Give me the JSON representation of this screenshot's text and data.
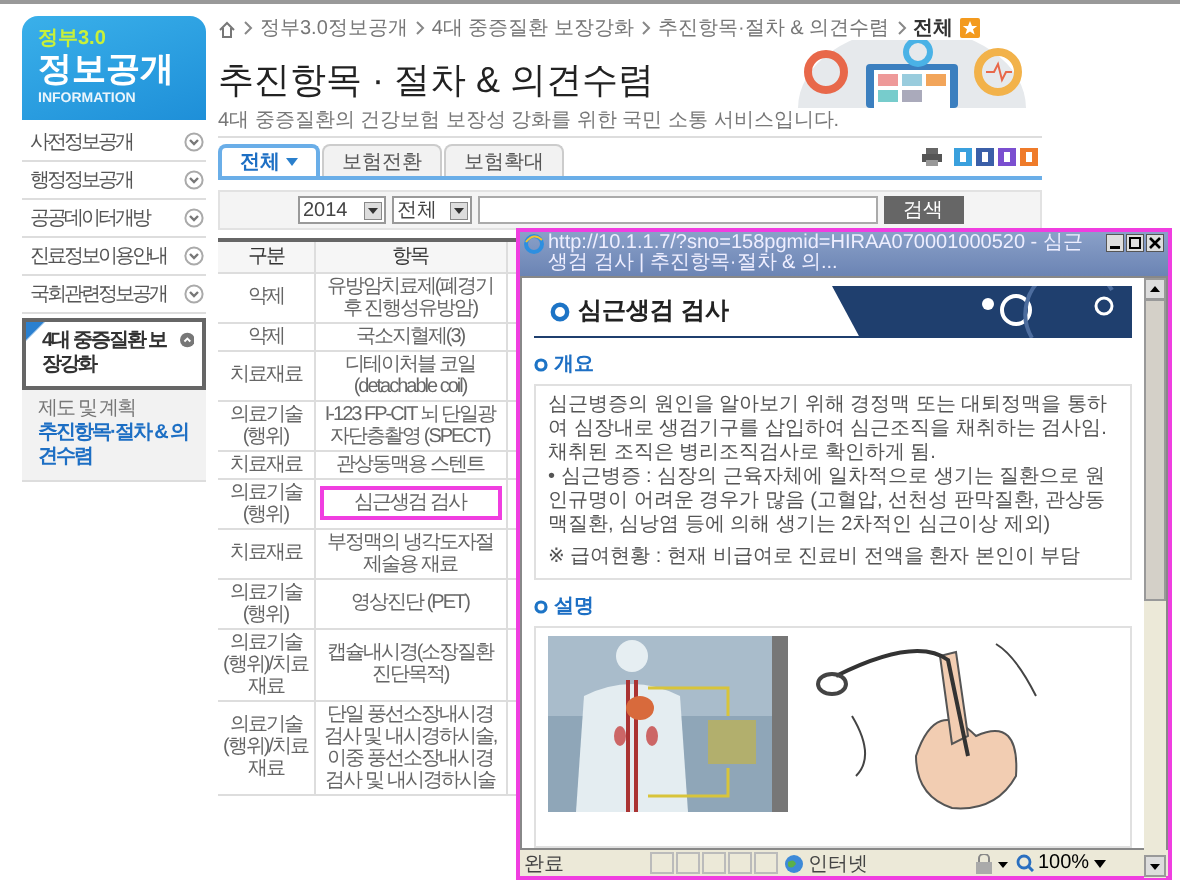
{
  "logo": {
    "badge": "정부3.0",
    "title": "정보공개",
    "subtitle": "INFORMATION"
  },
  "sidebar": {
    "items": [
      {
        "label": "사전정보공개",
        "selected": false
      },
      {
        "label": "행정정보공개",
        "selected": false
      },
      {
        "label": "공공데이터개방",
        "selected": false
      },
      {
        "label": "진료정보이용안내",
        "selected": false
      },
      {
        "label": "국회관련정보공개",
        "selected": false
      },
      {
        "label": "4대 중증질환 보장강화",
        "selected": true,
        "children": [
          {
            "label": "제도 및 계획",
            "selected": false
          },
          {
            "label": "추진항목·절차 & 의견수렴",
            "selected": true
          }
        ]
      }
    ]
  },
  "breadcrumb": [
    "정부3.0정보공개",
    "4대 중증질환 보장강화",
    "추진항목·절차 & 의견수렴",
    "전체"
  ],
  "page_title": "추진항목 · 절차 & 의견수렴",
  "page_subtitle": "4대 중증질환의 건강보험 보장성 강화를 위한 국민 소통 서비스입니다.",
  "tabs": [
    {
      "label": "전체",
      "selected": true
    },
    {
      "label": "보험전환",
      "selected": false
    },
    {
      "label": "보험확대",
      "selected": false
    }
  ],
  "filter": {
    "year": "2014",
    "category": "전체",
    "search_button": "검색"
  },
  "table": {
    "columns": [
      "구분",
      "항목"
    ],
    "rows": [
      {
        "cells": [
          "약제",
          "유방암치료제(폐경기 후 진행성유방암)"
        ],
        "selected": false
      },
      {
        "cells": [
          "약제",
          "국소지혈제(3)"
        ],
        "selected": false
      },
      {
        "cells": [
          "치료재료",
          "디테이처블 코일 (detachable coil)"
        ],
        "selected": false
      },
      {
        "cells": [
          "의료기술(행위)",
          "I-123 FP-CIT 뇌 단일광자단층촬영 (SPECT)"
        ],
        "selected": false
      },
      {
        "cells": [
          "치료재료",
          "관상동맥용 스텐트"
        ],
        "selected": false
      },
      {
        "cells": [
          "의료기술(행위)",
          "심근생검 검사"
        ],
        "selected": true
      },
      {
        "cells": [
          "치료재료",
          "부정맥의 냉각도자절제술용 재료"
        ],
        "selected": false
      },
      {
        "cells": [
          "의료기술(행위)",
          "영상진단 (PET)"
        ],
        "selected": false
      },
      {
        "cells": [
          "의료기술(행위)/치료재료",
          "캡슐내시경(소장질환 진단목적)"
        ],
        "selected": false
      },
      {
        "cells": [
          "의료기술(행위)/치료재료",
          "단일 풍선소장내시경 검사 및 내시경하시술, 이중 풍선소장내시경 검사 및 내시경하시술"
        ],
        "selected": false
      }
    ]
  },
  "popup": {
    "title": "http://10.1.1.7/?sno=158pgmid=HIRAA070001000520 - 심근생검 검사 | 추진항목·절차 & 의...",
    "heading": "심근생검 검사",
    "sections": [
      {
        "kind": "text",
        "heading": "개요",
        "paragraphs": [
          "심근병증의 원인을 알아보기 위해 경정맥 또는 대퇴정맥을 통하여 심장내로 생검기구를 삽입하여 심근조직을 채취하는 검사임. 채취된 조직은 병리조직검사로 확인하게 됨.",
          "• 심근병증 : 심장의 근육자체에 일차적으로 생기는 질환으로 원인규명이 어려운 경우가 많음 (고혈압, 선천성 판막질환, 관상동맥질환, 심낭염 등에 의해 생기는 2차적인 심근이상 제외)",
          "※ 급여현황 : 현재 비급여로 진료비 전액을 환자 본인이 부담"
        ]
      },
      {
        "kind": "pictures",
        "heading": "설명"
      }
    ],
    "status": "완료",
    "zone": "인터넷",
    "zoom": "100%"
  }
}
